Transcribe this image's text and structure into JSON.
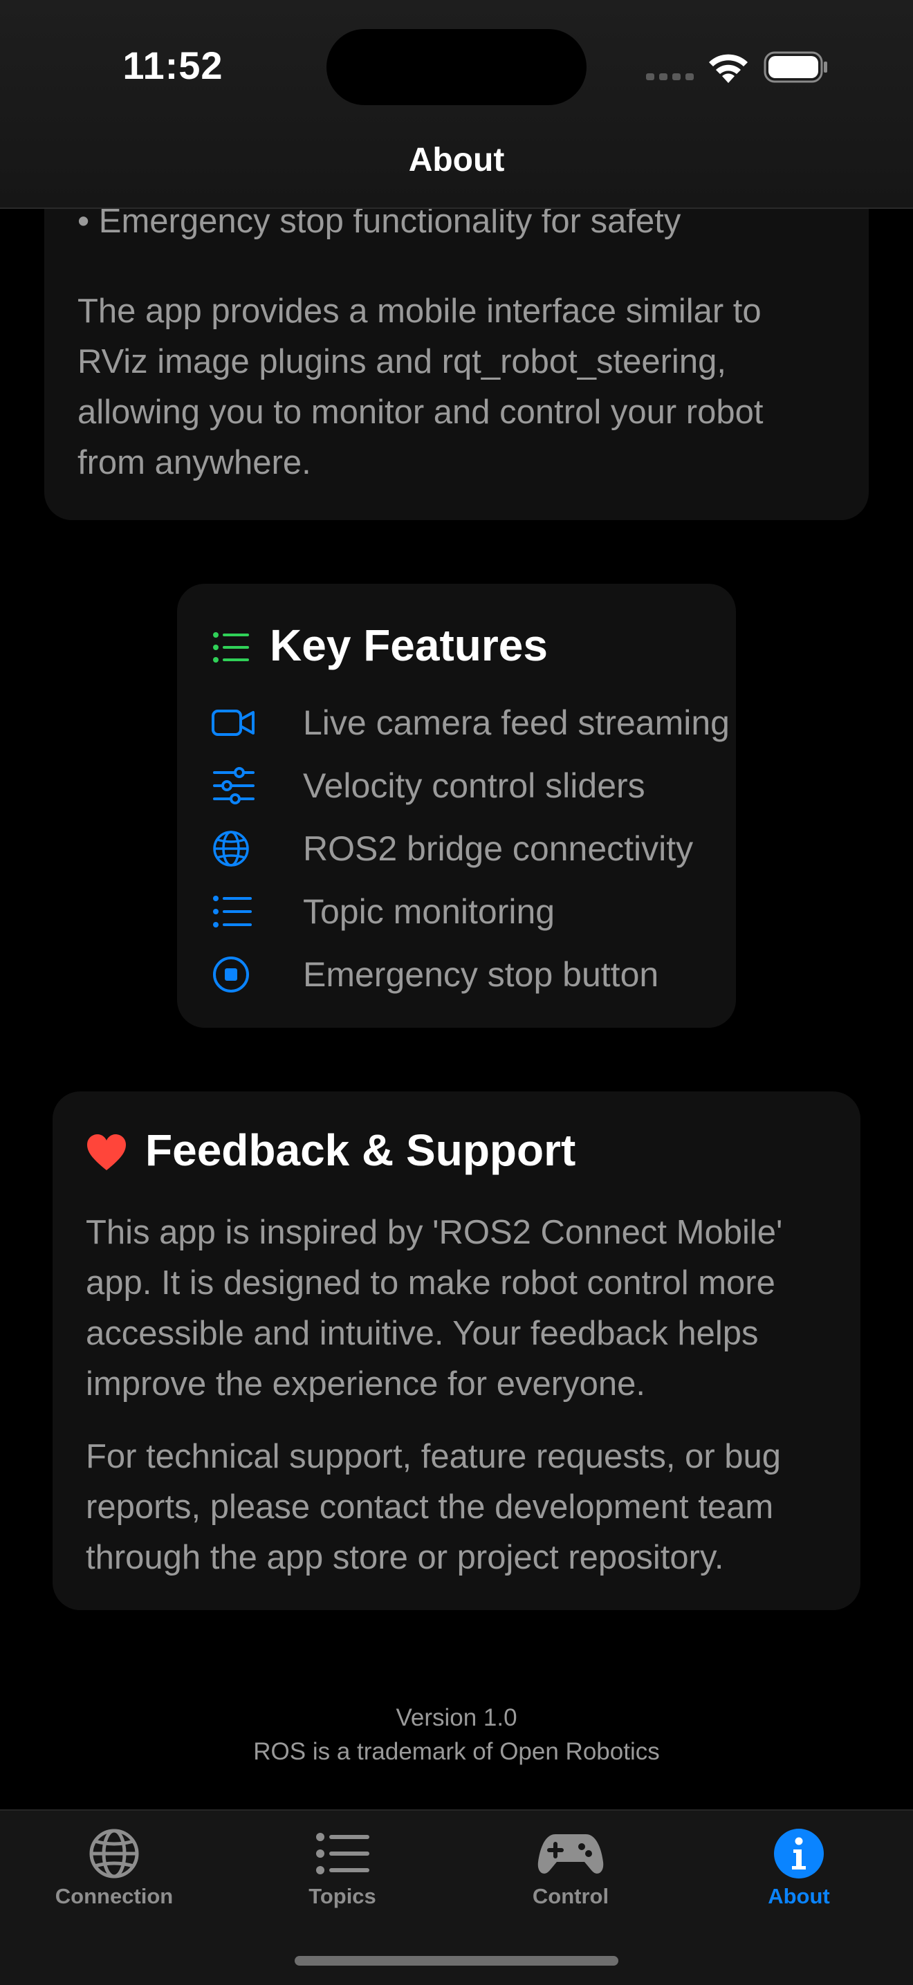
{
  "status_bar": {
    "time": "11:52"
  },
  "nav": {
    "title": "About"
  },
  "overview": {
    "bullet": "• Emergency stop functionality for safety",
    "paragraph": "The app provides a mobile interface similar to RViz image plugins and rqt_robot_steering, allowing you to monitor and control your robot from anywhere."
  },
  "features": {
    "title": "Key Features",
    "items": [
      {
        "label": "Live camera feed streaming",
        "icon": "video-camera-icon"
      },
      {
        "label": "Velocity control sliders",
        "icon": "sliders-icon"
      },
      {
        "label": "ROS2 bridge connectivity",
        "icon": "globe-icon"
      },
      {
        "label": "Topic monitoring",
        "icon": "list-icon"
      },
      {
        "label": "Emergency stop button",
        "icon": "stop-circle-icon"
      }
    ]
  },
  "feedback": {
    "title": "Feedback & Support",
    "paragraph1": "This app is inspired by 'ROS2 Connect Mobile' app. It is designed to make robot control more accessible and intuitive. Your feedback helps improve the experience for everyone.",
    "paragraph2": "For technical support, feature requests, or bug reports, please contact the development team through the app store or project repository."
  },
  "footer": {
    "version": "Version 1.0",
    "trademark": "ROS is a trademark of Open Robotics"
  },
  "tabs": [
    {
      "label": "Connection",
      "icon": "globe-icon",
      "active": false
    },
    {
      "label": "Topics",
      "icon": "list-icon",
      "active": false
    },
    {
      "label": "Control",
      "icon": "gamepad-icon",
      "active": false
    },
    {
      "label": "About",
      "icon": "info-icon",
      "active": true
    }
  ],
  "colors": {
    "accent": "#0a84ff",
    "features_icon": "#30d158",
    "heart": "#ff453a",
    "card": "#111111"
  }
}
